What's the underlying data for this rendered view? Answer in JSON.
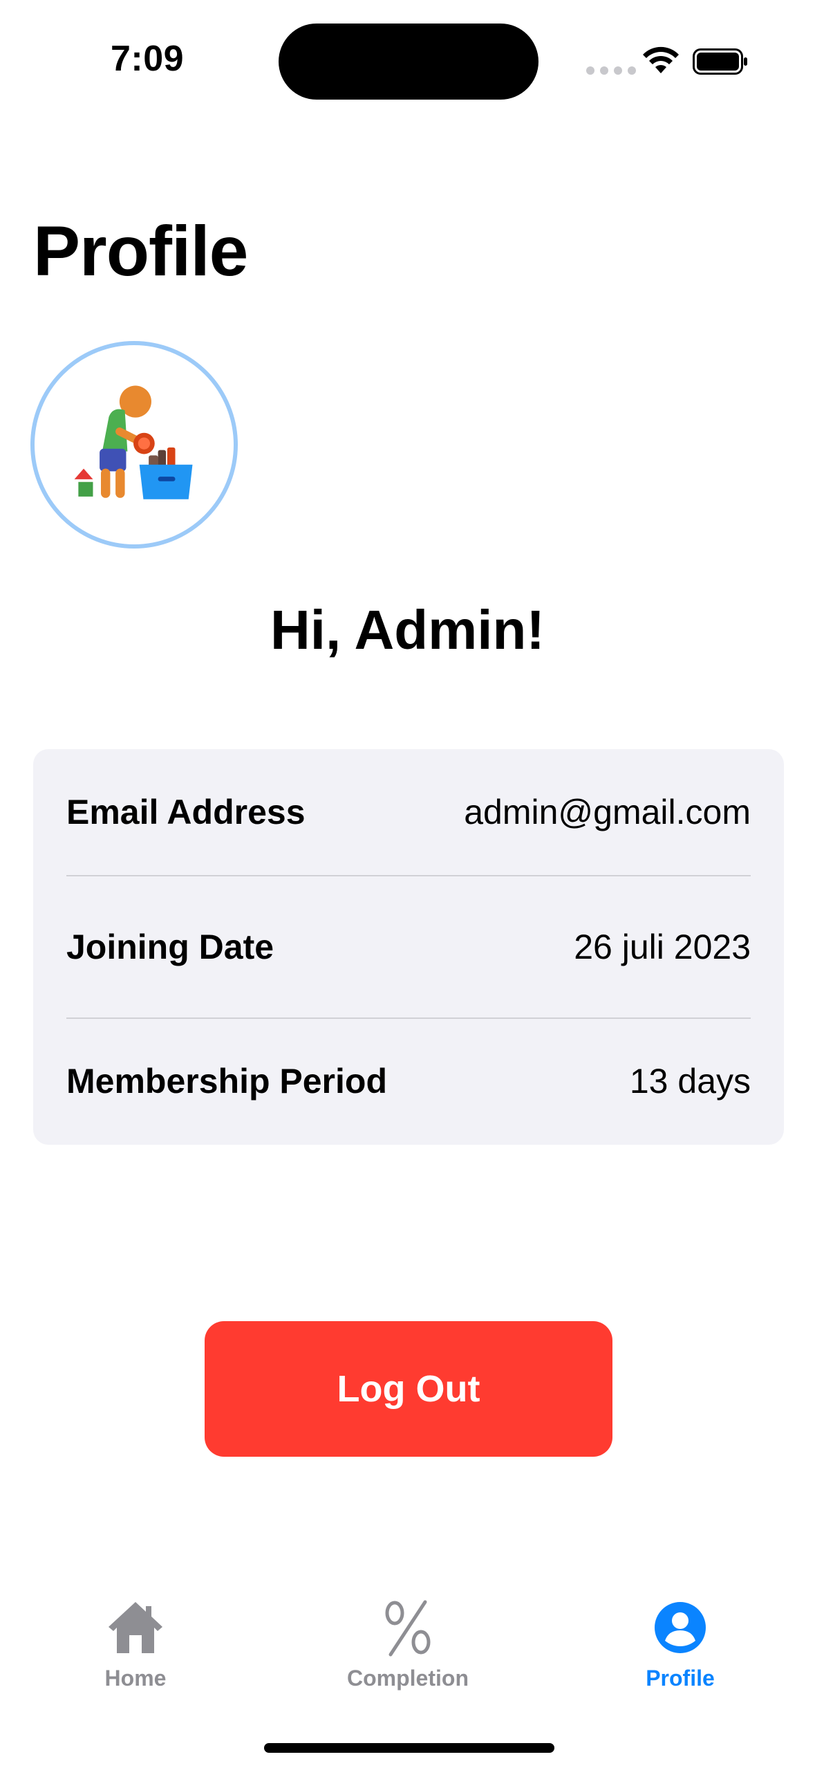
{
  "status_bar": {
    "time": "7:09",
    "wifi_icon": "wifi-icon",
    "battery_icon": "battery-full-icon"
  },
  "header": {
    "title": "Profile"
  },
  "avatar": {
    "icon": "child-packing-toys-illustration",
    "border_color": "#9ccaf8"
  },
  "greeting": "Hi, Admin!",
  "info": [
    {
      "label": "Email Address",
      "value": "admin@gmail.com"
    },
    {
      "label": "Joining Date",
      "value": "26 juli 2023"
    },
    {
      "label": "Membership Period",
      "value": "13 days"
    }
  ],
  "logout": {
    "label": "Log Out",
    "color": "#ff3b30"
  },
  "tab_bar": {
    "active_color": "#0a84ff",
    "inactive_color": "#8e8e93",
    "items": [
      {
        "label": "Home",
        "icon": "house-icon",
        "active": false
      },
      {
        "label": "Completion",
        "icon": "percent-icon",
        "active": false
      },
      {
        "label": "Profile",
        "icon": "person-circle-icon",
        "active": true
      }
    ]
  }
}
